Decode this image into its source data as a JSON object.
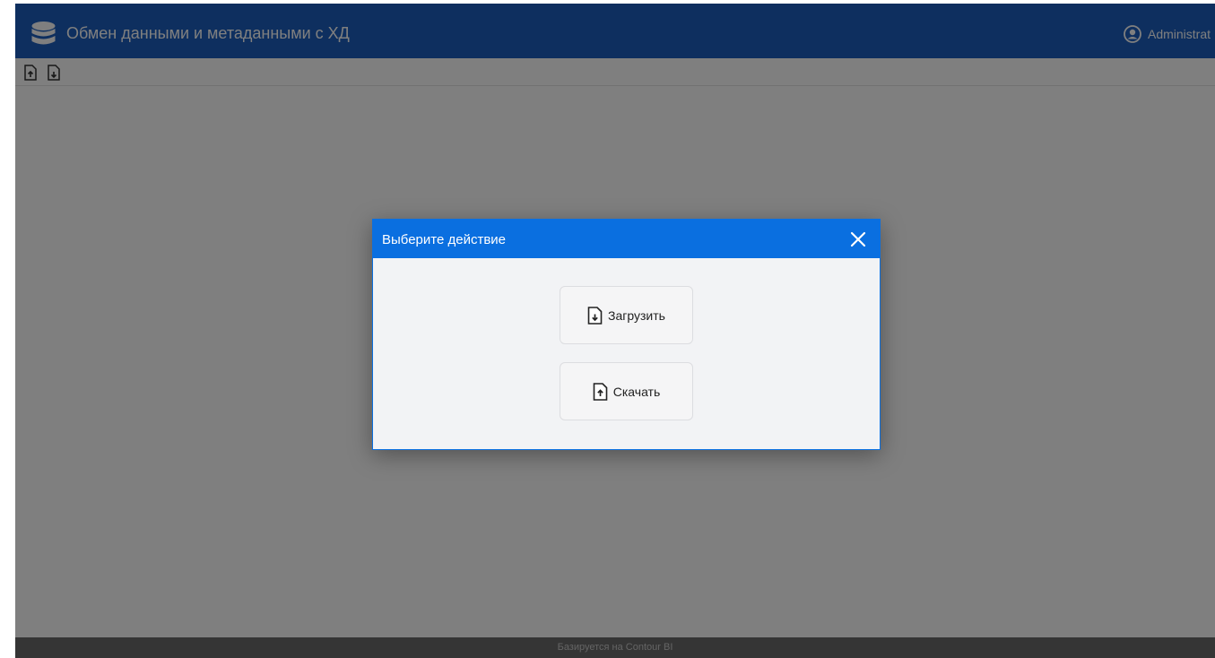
{
  "header": {
    "title": "Обмен данными и метаданными с ХД",
    "user_label": "Administrat",
    "icons": [
      "database-icon",
      "user-circle-icon"
    ],
    "background": "#1d5fbf"
  },
  "toolbar": {
    "icons": [
      "file-upload-icon",
      "file-download-icon"
    ]
  },
  "modal": {
    "title": "Выберите действие",
    "header_color": "#0a6fe0",
    "close_icon": "close-icon",
    "buttons": [
      {
        "label": "Загрузить",
        "icon": "file-download-icon"
      },
      {
        "label": "Скачать",
        "icon": "file-upload-icon"
      }
    ]
  },
  "footer": {
    "text": "Базируется на Contour BI"
  }
}
